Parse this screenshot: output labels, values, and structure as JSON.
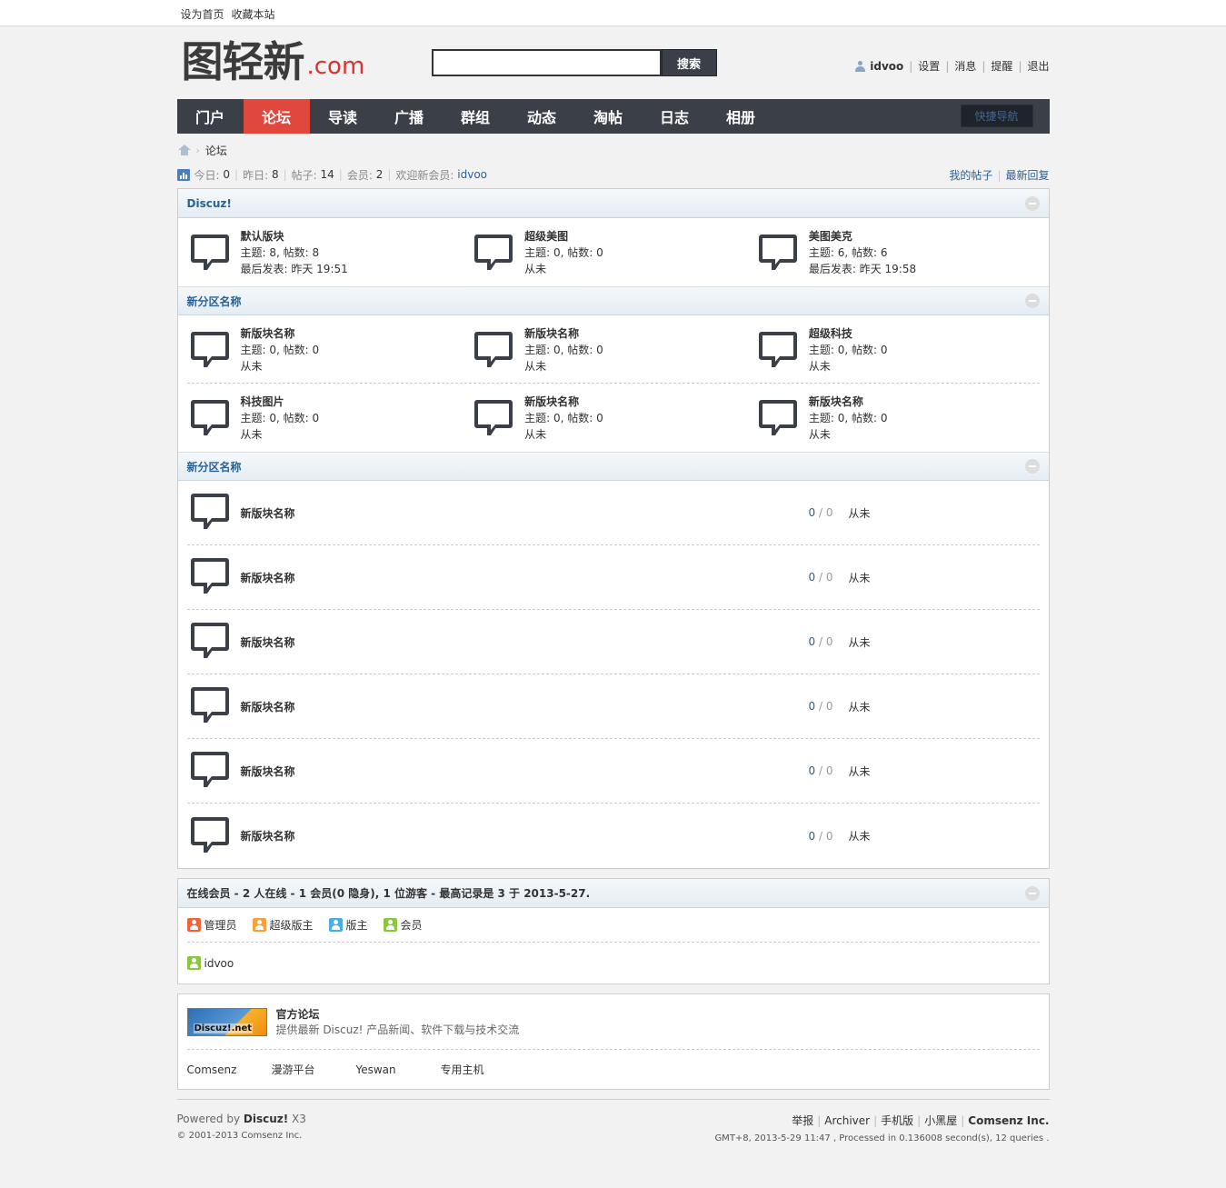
{
  "topbar": {
    "set_home": "设为首页",
    "favorite": "收藏本站"
  },
  "logo": {
    "main": "图轻新",
    "suffix": ".com"
  },
  "search": {
    "button": "搜索",
    "value": ""
  },
  "usernav": {
    "username": "idvoo",
    "settings": "设置",
    "messages": "消息",
    "notices": "提醒",
    "logout": "退出"
  },
  "nav": {
    "items": [
      "门户",
      "论坛",
      "导读",
      "广播",
      "群组",
      "动态",
      "淘帖",
      "日志",
      "相册"
    ],
    "active": "论坛",
    "quicknav": "快捷导航"
  },
  "breadcrumb": {
    "current": "论坛"
  },
  "stats": {
    "today_label": "今日:",
    "today": "0",
    "yesterday_label": "昨日:",
    "yesterday": "8",
    "posts_label": "帖子:",
    "posts": "14",
    "members_label": "会员:",
    "members": "2",
    "welcome": "欢迎新会员:",
    "newest": "idvoo",
    "my_posts": "我的帖子",
    "latest_replies": "最新回复"
  },
  "categories": [
    {
      "title": "Discuz!",
      "rows": [
        [
          {
            "name": "默认版块",
            "line1": "主题: 8, 帖数: 8",
            "line2": "最后发表: 昨天 19:51"
          },
          {
            "name": "超级美图",
            "line1": "主题: 0, 帖数: 0",
            "line2": "从未"
          },
          {
            "name": "美图美克",
            "line1": "主题: 6, 帖数: 6",
            "line2": "最后发表: 昨天 19:58"
          }
        ]
      ]
    },
    {
      "title": "新分区名称",
      "rows": [
        [
          {
            "name": "新版块名称",
            "line1": "主题: 0, 帖数: 0",
            "line2": "从未"
          },
          {
            "name": "新版块名称",
            "line1": "主题: 0, 帖数: 0",
            "line2": "从未"
          },
          {
            "name": "超级科技",
            "line1": "主题: 0, 帖数: 0",
            "line2": "从未"
          }
        ],
        [
          {
            "name": "科技图片",
            "line1": "主题: 0, 帖数: 0",
            "line2": "从未"
          },
          {
            "name": "新版块名称",
            "line1": "主题: 0, 帖数: 0",
            "line2": "从未"
          },
          {
            "name": "新版块名称",
            "line1": "主题: 0, 帖数: 0",
            "line2": "从未"
          }
        ]
      ]
    },
    {
      "title": "新分区名称",
      "list": [
        {
          "name": "新版块名称",
          "threads": "0",
          "slash": " / ",
          "posts": "0",
          "last": "从未"
        },
        {
          "name": "新版块名称",
          "threads": "0",
          "slash": " / ",
          "posts": "0",
          "last": "从未"
        },
        {
          "name": "新版块名称",
          "threads": "0",
          "slash": " / ",
          "posts": "0",
          "last": "从未"
        },
        {
          "name": "新版块名称",
          "threads": "0",
          "slash": " / ",
          "posts": "0",
          "last": "从未"
        },
        {
          "name": "新版块名称",
          "threads": "0",
          "slash": " / ",
          "posts": "0",
          "last": "从未"
        },
        {
          "name": "新版块名称",
          "threads": "0",
          "slash": " / ",
          "posts": "0",
          "last": "从未"
        }
      ]
    }
  ],
  "online": {
    "title": "在线会员 - 2 人在线 - 1 会员(0 隐身), 1 位游客 - 最高记录是 3 于 2013-5-27.",
    "legend": [
      {
        "label": "管理员",
        "color": "#f0643c"
      },
      {
        "label": "超级版主",
        "color": "#f5a23a"
      },
      {
        "label": "版主",
        "color": "#4aaee6"
      },
      {
        "label": "会员",
        "color": "#8cc63f"
      }
    ],
    "users": [
      {
        "name": "idvoo",
        "color": "#8cc63f"
      }
    ]
  },
  "links": {
    "logo_text": "Discuz!.net",
    "title": "官方论坛",
    "desc": "提供最新 Discuz! 产品新闻、软件下载与技术交流",
    "text_links": [
      "Comsenz",
      "漫游平台",
      "Yeswan",
      "专用主机"
    ]
  },
  "footer": {
    "powered": "Powered by ",
    "brand": "Discuz!",
    "version": " X3",
    "copyright": "© 2001-2013 Comsenz Inc.",
    "links": [
      "举报",
      "Archiver",
      "手机版",
      "小黑屋"
    ],
    "company": "Comsenz Inc.",
    "meta": "GMT+8, 2013-5-29 11:47 , Processed in 0.136008 second(s), 12 queries ."
  }
}
